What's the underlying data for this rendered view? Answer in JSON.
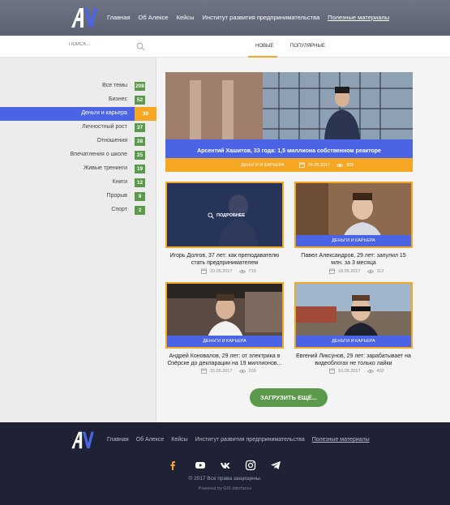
{
  "header": {
    "logo_text": "AV",
    "nav": [
      "Главная",
      "Об Алексе",
      "Кейсы",
      "Институт развития предпринимательства",
      "Полезные материалы"
    ]
  },
  "sidebar": {
    "search_placeholder": "ПОИСК...",
    "categories": [
      {
        "label": "Все темы",
        "count": "208"
      },
      {
        "label": "Бизнес",
        "count": "52"
      },
      {
        "label": "Деньги и карьера",
        "count": "30"
      },
      {
        "label": "Личностный рост",
        "count": "37"
      },
      {
        "label": "Отношения",
        "count": "28"
      },
      {
        "label": "Впечатления о школе",
        "count": "25"
      },
      {
        "label": "Живые тренинги",
        "count": "19"
      },
      {
        "label": "Книги",
        "count": "12"
      },
      {
        "label": "Прорыв",
        "count": "8"
      },
      {
        "label": "Спорт",
        "count": "2"
      }
    ]
  },
  "tabs": {
    "new": "НОВЫЕ",
    "popular": "ПОПУЛЯРНЫЕ"
  },
  "featured": {
    "title": "Арсентий Хашитов, 33 года: 1,5 миллиона собственном реакторе",
    "category": "ДЕНЬГИ И КАРЬЕРА",
    "date": "24.05.2017",
    "views": "805"
  },
  "cards": [
    {
      "badge": "",
      "hover": "ПОДРОБНЕЕ",
      "title": "Игорь Долгов, 37 лет: как преподавателю стать предпринимателем",
      "date": "20.05.2017",
      "views": "719"
    },
    {
      "badge": "ДЕНЬГИ И КАРЬЕРА",
      "title": "Павел Александров, 29 лет: запулил 15 млн. за 3 месяца",
      "date": "18.05.2017",
      "views": "112"
    },
    {
      "badge": "ДЕНЬГИ И КАРЬЕРА",
      "title": "Андрей Коновалов, 29 лет: от электрика в Озёрске до декларации на 19 миллионов...",
      "date": "15.05.2017",
      "views": "203"
    },
    {
      "badge": "ДЕНЬГИ И КАРЬЕРА",
      "title": "Евгений Ликсунов, 29 лет: зарабатывает на видеоблогах не только лайки",
      "date": "10.05.2017",
      "views": "402"
    }
  ],
  "load_more": "ЗАГРУЗИТЬ ЕЩЁ...",
  "footer": {
    "logo_text": "AV",
    "nav": [
      "Главная",
      "Об Алексе",
      "Кейсы",
      "Институт развития предпринимательства",
      "Полезные материалы"
    ],
    "socials": [
      "facebook-icon",
      "youtube-icon",
      "vk-icon",
      "instagram-icon",
      "telegram-icon"
    ],
    "copyright": "© 2017 Все права защищены.",
    "powered": "Powered by GIS interfaces"
  },
  "colors": {
    "accent_blue": "#4b64e6",
    "accent_orange": "#f5a623",
    "green": "#5a9a4a",
    "footer_bg": "#1f2235"
  }
}
